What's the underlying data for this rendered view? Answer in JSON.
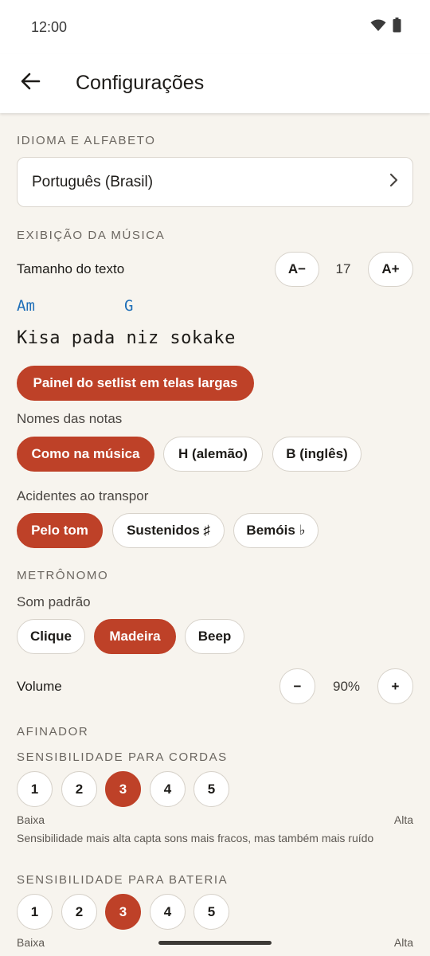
{
  "status": {
    "time": "12:00"
  },
  "header": {
    "title": "Configurações"
  },
  "language": {
    "section": "IDIOMA E ALFABETO",
    "value": "Português (Brasil)"
  },
  "display": {
    "section": "EXIBIÇÃO DA MÚSICA",
    "text_size_label": "Tamanho do texto",
    "decrease": "A−",
    "increase": "A+",
    "text_size_value": "17",
    "preview_chord_1": "Am",
    "preview_chord_2": "G",
    "preview_lyric": "Kisa pada niz sokake",
    "setlist_panel": "Painel do setlist em telas largas",
    "note_names_label": "Nomes das notas",
    "note_names": [
      "Como na música",
      "H (alemão)",
      "B (inglês)"
    ],
    "note_names_selected": 0,
    "accidentals_label": "Acidentes ao transpor",
    "accidentals": [
      "Pelo tom",
      "Sustenidos ♯",
      "Bemóis ♭"
    ],
    "accidentals_selected": 0
  },
  "metronome": {
    "section": "METRÔNOMO",
    "sound_label": "Som padrão",
    "sounds": [
      "Clique",
      "Madeira",
      "Beep"
    ],
    "sound_selected": 1,
    "volume_label": "Volume",
    "volume_minus": "−",
    "volume_plus": "+",
    "volume_value": "90%"
  },
  "tuner": {
    "section": "AFINADOR",
    "strings_section": "SENSIBILIDADE PARA CORDAS",
    "strings_levels": [
      "1",
      "2",
      "3",
      "4",
      "5"
    ],
    "strings_selected": 2,
    "low_label": "Baixa",
    "high_label": "Alta",
    "hint": "Sensibilidade mais alta capta sons mais fracos, mas também mais ruído",
    "drums_section": "SENSIBILIDADE PARA BATERIA",
    "drums_levels": [
      "1",
      "2",
      "3",
      "4",
      "5"
    ],
    "drums_selected": 2,
    "drums_low_label": "Baixa",
    "drums_high_label": "Alta"
  },
  "colors": {
    "accent": "#be4128",
    "chord": "#1f6fb8",
    "background": "#f7f4ee"
  },
  "icons": {
    "back": "arrow-left-icon",
    "chevron": "chevron-right-icon",
    "wifi": "wifi-icon",
    "battery": "battery-icon"
  }
}
